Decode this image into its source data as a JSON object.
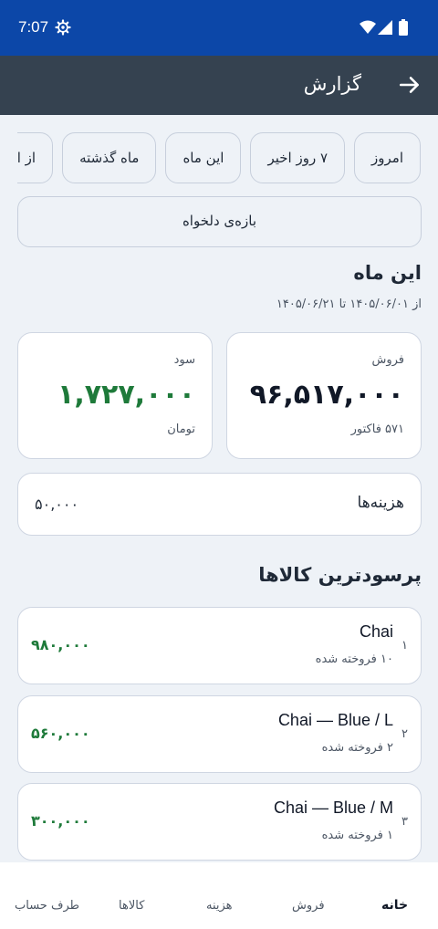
{
  "status": {
    "time": "7:07"
  },
  "appbar": {
    "title": "گزارش"
  },
  "chips": [
    "امروز",
    "۷ روز اخیر",
    "این ماه",
    "ماه گذشته",
    "از اول"
  ],
  "custom_range": "بازه‌ی دلخواه",
  "period": {
    "title": "این ماه",
    "range": "از ۱۴۰۵/۰۶/۰۱ تا ۱۴۰۵/۰۶/۲۱"
  },
  "sales": {
    "label": "فروش",
    "value": "۹۶,۵۱۷,۰۰۰",
    "sub": "۵۷۱ فاکتور"
  },
  "profit": {
    "label": "سود",
    "value": "۱,۷۲۷,۰۰۰",
    "sub": "تومان"
  },
  "expenses": {
    "label": "هزینه‌ها",
    "value": "۵۰,۰۰۰"
  },
  "top_products": {
    "title": "پرسودترین کالاها",
    "items": [
      {
        "rank": "۱",
        "name": "Chai",
        "sold": "۱۰ فروخته شده",
        "profit": "۹۸۰,۰۰۰"
      },
      {
        "rank": "۲",
        "name": "Chai — Blue / L",
        "sold": "۲ فروخته شده",
        "profit": "۵۶۰,۰۰۰"
      },
      {
        "rank": "۳",
        "name": "Chai — Blue / M",
        "sold": "۱ فروخته شده",
        "profit": "۳۰۰,۰۰۰"
      }
    ]
  },
  "nav": {
    "home": "خانه",
    "sales": "فروش",
    "expenses": "هزینه",
    "products": "کالاها",
    "accounts": "طرف حساب"
  },
  "colors": {
    "statusbar": "#0c47a8",
    "appbar": "#354250",
    "profit": "#1e7a3a"
  },
  "icons": [
    "settings-gear-icon",
    "wifi-icon",
    "cell-signal-icon",
    "battery-icon",
    "arrow-forward-icon"
  ]
}
